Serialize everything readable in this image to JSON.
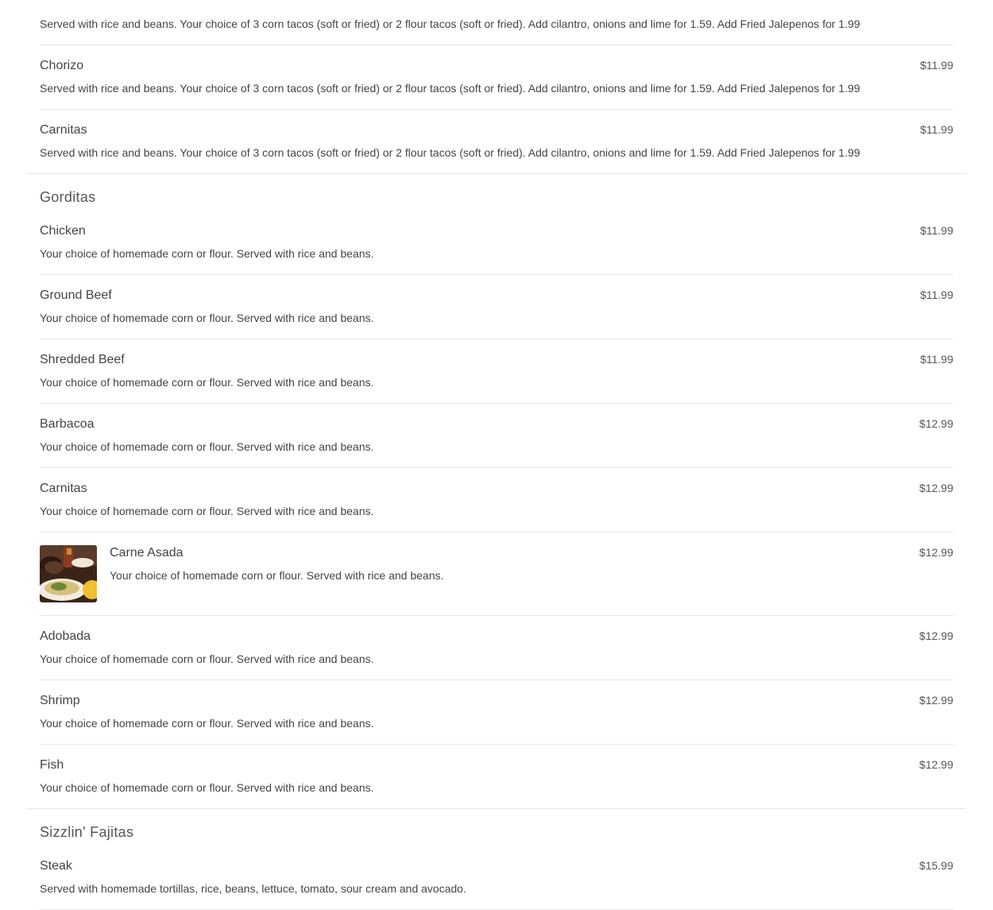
{
  "sections": [
    {
      "title": "",
      "items": [
        {
          "name": "",
          "desc": "Served with rice and beans. Your choice of 3 corn tacos (soft or fried) or 2 flour tacos (soft or fried). Add cilantro, onions and lime for 1.59. Add Fried Jalepenos for 1.99",
          "price": ""
        },
        {
          "name": "Chorizo",
          "desc": "Served with rice and beans. Your choice of 3 corn tacos (soft or fried) or 2 flour tacos (soft or fried). Add cilantro, onions and lime for 1.59. Add Fried Jalepenos for 1.99",
          "price": "$11.99"
        },
        {
          "name": "Carnitas",
          "desc": "Served with rice and beans. Your choice of 3 corn tacos (soft or fried) or 2 flour tacos (soft or fried). Add cilantro, onions and lime for 1.59. Add Fried Jalepenos for 1.99",
          "price": "$11.99"
        }
      ]
    },
    {
      "title": "Gorditas",
      "items": [
        {
          "name": "Chicken",
          "desc": "Your choice of homemade corn or flour. Served with rice and beans.",
          "price": "$11.99"
        },
        {
          "name": "Ground Beef",
          "desc": "Your choice of homemade corn or flour. Served with rice and beans.",
          "price": "$11.99"
        },
        {
          "name": "Shredded Beef",
          "desc": "Your choice of homemade corn or flour. Served with rice and beans.",
          "price": "$11.99"
        },
        {
          "name": "Barbacoa",
          "desc": "Your choice of homemade corn or flour. Served with rice and beans.",
          "price": "$12.99"
        },
        {
          "name": "Carnitas",
          "desc": "Your choice of homemade corn or flour. Served with rice and beans.",
          "price": "$12.99"
        },
        {
          "name": "Carne Asada",
          "desc": "Your choice of homemade corn or flour. Served with rice and beans.",
          "price": "$12.99",
          "image": "food-photo"
        },
        {
          "name": "Adobada",
          "desc": "Your choice of homemade corn or flour. Served with rice and beans.",
          "price": "$12.99"
        },
        {
          "name": "Shrimp",
          "desc": "Your choice of homemade corn or flour. Served with rice and beans.",
          "price": "$12.99"
        },
        {
          "name": "Fish",
          "desc": "Your choice of homemade corn or flour. Served with rice and beans.",
          "price": "$12.99"
        }
      ]
    },
    {
      "title": "Sizzlin' Fajitas",
      "items": [
        {
          "name": "Steak",
          "desc": "Served with homemade tortillas, rice, beans, lettuce, tomato, sour cream and avocado.",
          "price": "$15.99"
        }
      ]
    }
  ]
}
